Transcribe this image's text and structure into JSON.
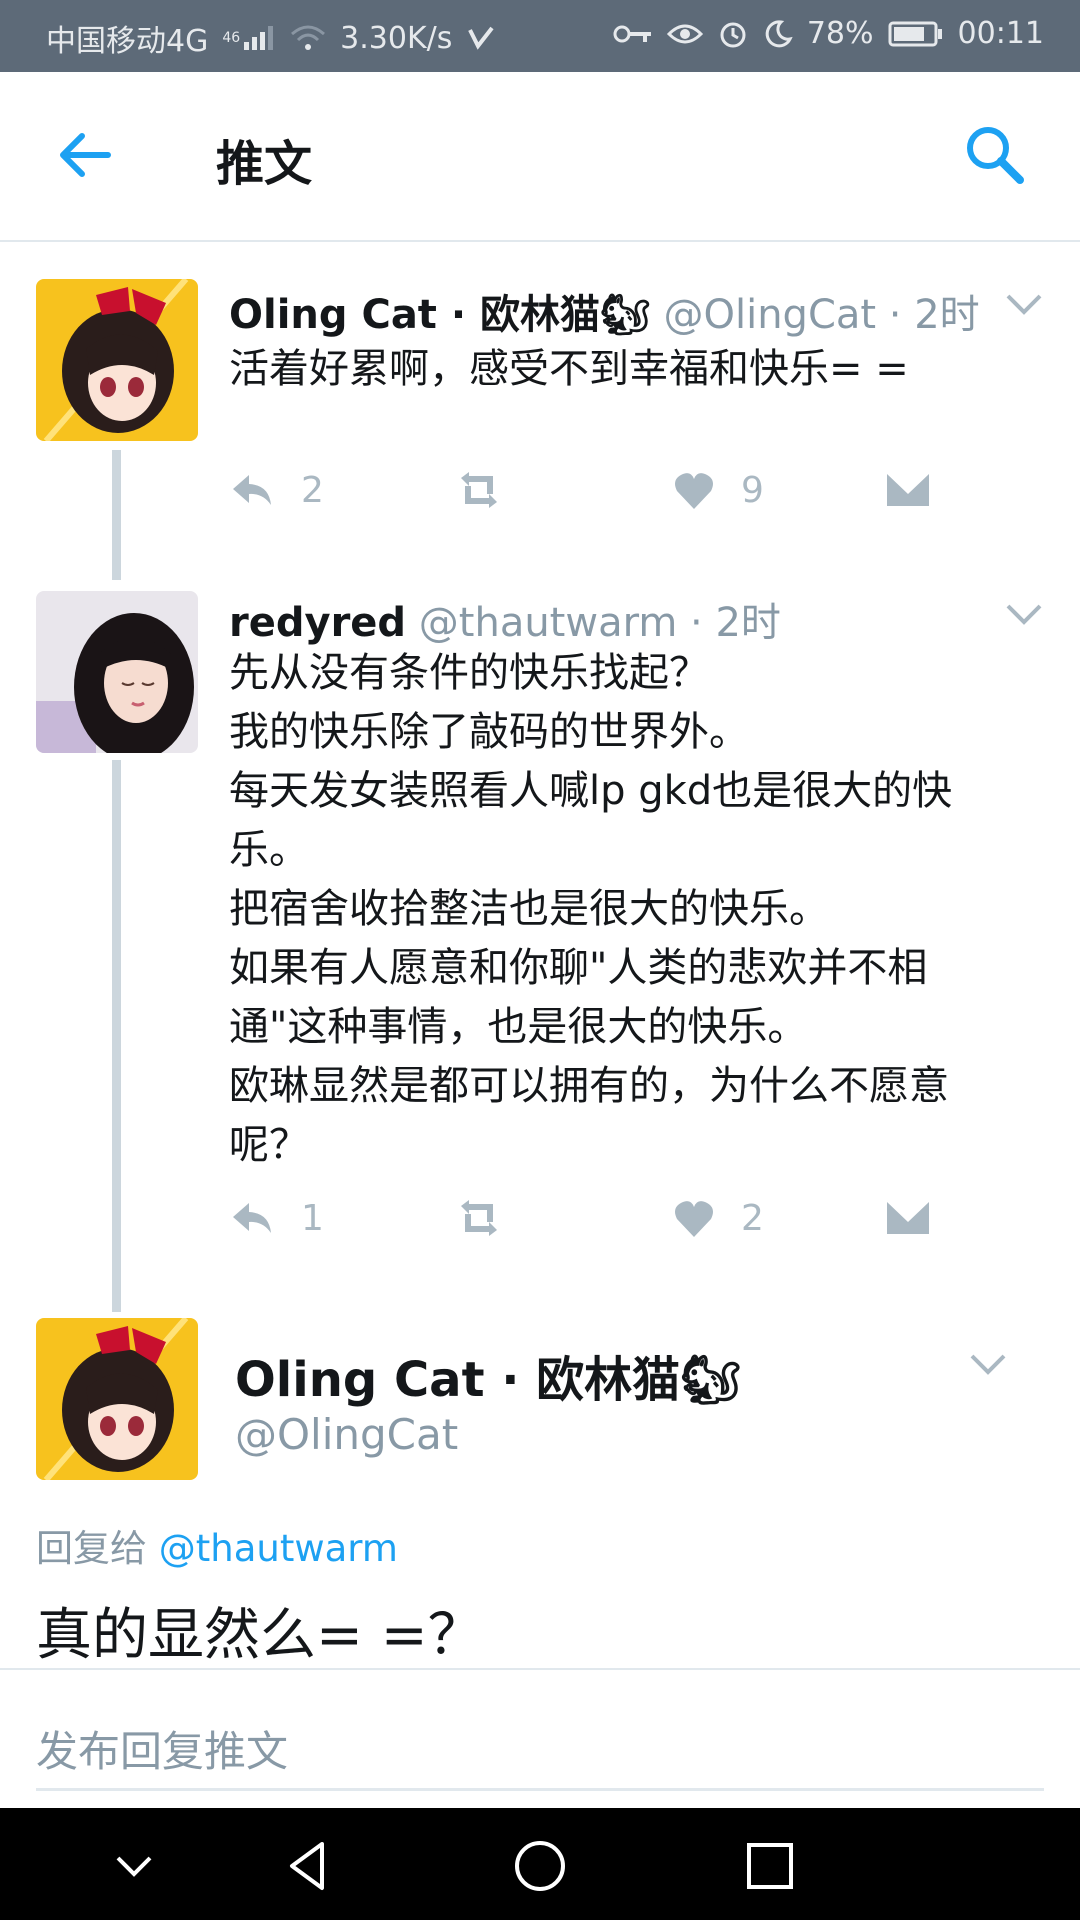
{
  "status_bar": {
    "carrier": "中国移动4G",
    "network_badge": "46",
    "speed": "3.30K/s",
    "battery": "78%",
    "time": "00:11",
    "icons": [
      "signal-icon",
      "wifi-icon",
      "check-icon",
      "key-icon",
      "eye-icon",
      "alarm-icon",
      "moon-icon",
      "battery-icon"
    ]
  },
  "header": {
    "title": "推文",
    "back_icon": "arrow-left-icon",
    "search_icon": "search-icon",
    "accent_color": "#1da1f2"
  },
  "thread": [
    {
      "name": "Oling Cat · 欧林猫🐿",
      "handle": "@OlingCat",
      "time": "2时",
      "lines": [
        "活着好累啊，感受不到幸福和快乐= ="
      ],
      "replies": "2",
      "retweets": "",
      "likes": "9"
    },
    {
      "name": "redyred",
      "handle": "@thautwarm",
      "time": "2时",
      "lines": [
        "先从没有条件的快乐找起？",
        "我的快乐除了敲码的世界外。",
        "每天发女装照看人喊lp gkd也是很大的快",
        "乐。",
        "把宿舍收拾整洁也是很大的快乐。",
        "如果有人愿意和你聊\"人类的悲欢并不相",
        "通\"这种事情，也是很大的快乐。",
        "欧琳显然是都可以拥有的，为什么不愿意",
        "呢？"
      ],
      "replies": "1",
      "retweets": "",
      "likes": "2"
    }
  ],
  "focused": {
    "name": "Oling Cat · 欧林猫🐿",
    "handle": "@OlingCat",
    "reply_prefix": "回复给",
    "reply_to": "@thautwarm",
    "text": "真的显然么= =？"
  },
  "composer": {
    "placeholder": "发布回复推文"
  },
  "nav": {
    "icons": [
      "chevron-down-icon",
      "back-triangle-icon",
      "home-circle-icon",
      "recents-square-icon"
    ]
  }
}
